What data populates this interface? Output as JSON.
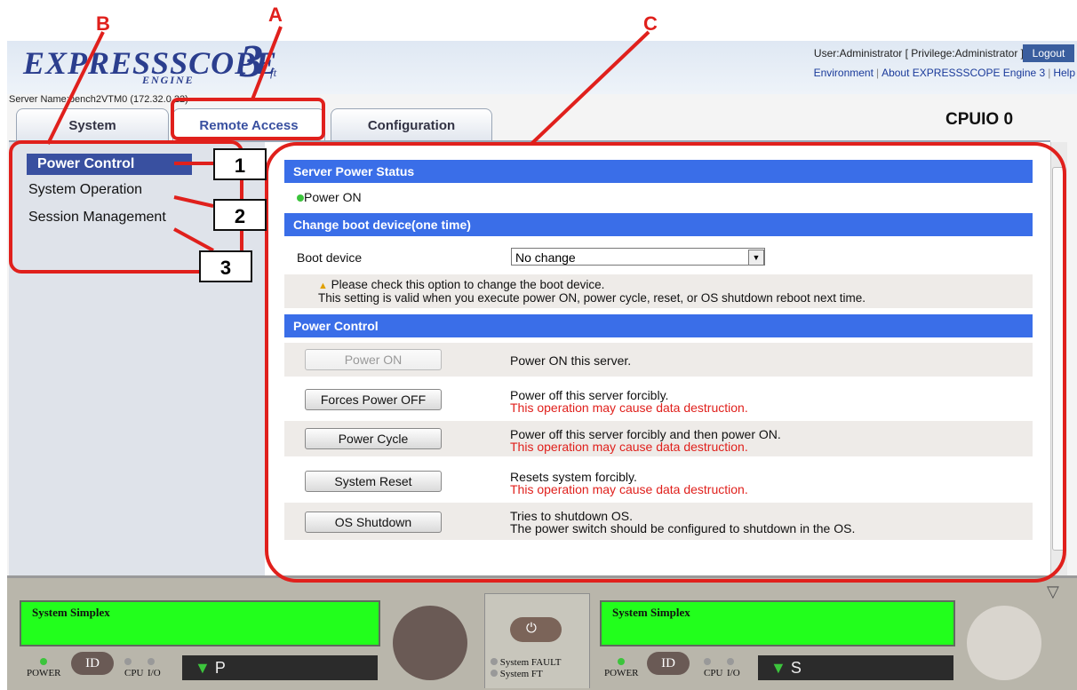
{
  "annotations": {
    "a": "A",
    "b": "B",
    "c": "C",
    "n1": "1",
    "n2": "2",
    "n3": "3"
  },
  "header": {
    "logo_text": "EXPRESSSCOPE",
    "logo_engine": "ENGINE",
    "logo_num": "3",
    "logo_ft": "ft",
    "user_info": "User:Administrator [ Privilege:Administrator ]",
    "logout_label": "Logout",
    "links": [
      "Environment",
      "About EXPRESSSCOPE Engine 3",
      "Help"
    ],
    "server_name": "Server Name:bench2VTM0 (172.32.0.22)"
  },
  "tabs": [
    "System",
    "Remote Access",
    "Configuration"
  ],
  "module_title": "CPUIO 0",
  "sidebar": {
    "items": [
      "Power Control",
      "System Operation",
      "Session Management"
    ]
  },
  "content": {
    "power_status": {
      "heading": "Server Power Status",
      "status": "Power ON"
    },
    "boot": {
      "heading": "Change boot device(one time)",
      "label": "Boot device",
      "selected": "No change",
      "note_line1": "Please check this option to change the boot device.",
      "note_line2": "This setting is valid when you execute power ON, power cycle, reset, or OS shutdown reboot next time."
    },
    "power_control": {
      "heading": "Power Control",
      "rows": [
        {
          "button": "Power ON",
          "desc1": "Power ON this server.",
          "desc2": ""
        },
        {
          "button": "Forces Power OFF",
          "desc1": "Power off this server forcibly.",
          "desc2": "This operation may cause data destruction."
        },
        {
          "button": "Power Cycle",
          "desc1": "Power off this server forcibly and then power ON.",
          "desc2": "This operation may cause data destruction."
        },
        {
          "button": "System Reset",
          "desc1": "Resets system forcibly.",
          "desc2": "This operation may cause data destruction."
        },
        {
          "button": "OS Shutdown",
          "desc1": "Tries to shutdown OS.",
          "desc2": "The power switch should be configured to shutdown in the OS."
        }
      ]
    }
  },
  "panel": {
    "left_lcd": "System Simplex",
    "right_lcd": "System Simplex",
    "power_label": "POWER",
    "id_label": "ID",
    "cpu_label": "CPU",
    "io_label": "I/O",
    "left_display": "P",
    "right_display": "S",
    "fault_label": "System FAULT",
    "ft_label": "System FT"
  },
  "colors": {
    "annotation": "#e0201c",
    "section_header": "#3a6ee8",
    "nav_active": "#3950a0",
    "lcd": "#22ff1c"
  }
}
